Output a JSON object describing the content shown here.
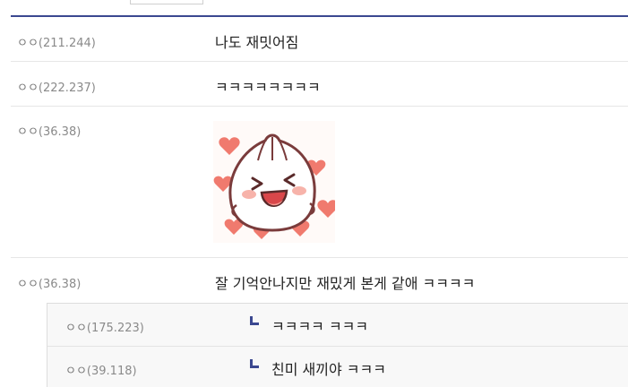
{
  "comments": [
    {
      "nick": "ㅇㅇ",
      "ip": "(211.244)",
      "text": "나도 재밋어짐"
    },
    {
      "nick": "ㅇㅇ",
      "ip": "(222.237)",
      "text": "ㅋㅋㅋㅋㅋㅋㅋㅋ"
    },
    {
      "nick": "ㅇㅇ",
      "ip": "(36.38)",
      "sticker": "dumpling-sticker"
    },
    {
      "nick": "ㅇㅇ",
      "ip": "(36.38)",
      "text": "잘 기억안나지만 재밌게 본게 같애 ㅋㅋㅋㅋ"
    }
  ],
  "replies": [
    {
      "nick": "ㅇㅇ",
      "ip": "(175.223)",
      "text": "ㅋㅋㅋㅋ ㅋㅋㅋ"
    },
    {
      "nick": "ㅇㅇ",
      "ip": "(39.118)",
      "text": "친미 새끼야 ㅋㅋㅋ"
    }
  ],
  "colors": {
    "accent": "#3b4890",
    "nick": "#777777",
    "text": "#222222"
  }
}
